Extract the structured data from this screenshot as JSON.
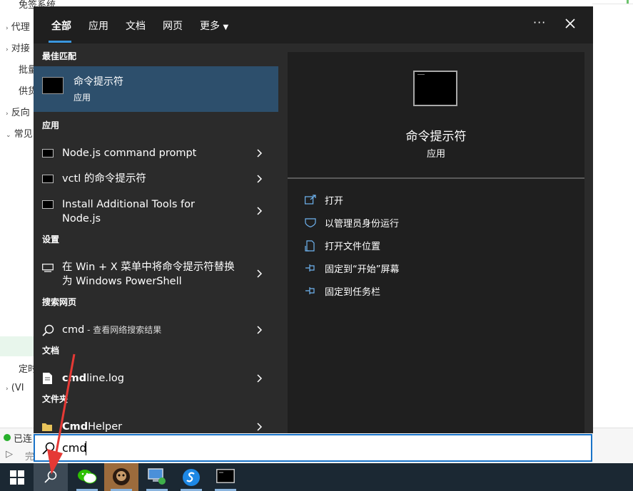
{
  "background_app": {
    "side_items": [
      "免签系统",
      "代理",
      "对接",
      "批量",
      "供货",
      "反向",
      "常见",
      "定时",
      "(VI"
    ],
    "status": "已连",
    "bottom_label": "完"
  },
  "search": {
    "tabs": [
      {
        "label": "全部",
        "active": true
      },
      {
        "label": "应用"
      },
      {
        "label": "文档"
      },
      {
        "label": "网页"
      },
      {
        "label": "更多"
      }
    ],
    "more_icon": "ellipsis-icon",
    "close_icon": "close-icon",
    "sections": {
      "best_match": "最佳匹配",
      "apps": "应用",
      "settings": "设置",
      "web": "搜索网页",
      "docs": "文档",
      "folders": "文件夹"
    },
    "best": {
      "title": "命令提示符",
      "subtitle": "应用"
    },
    "apps": [
      {
        "label": "Node.js command prompt"
      },
      {
        "label": "vctl 的命令提示符"
      },
      {
        "label": "Install Additional Tools for Node.js"
      }
    ],
    "setting": {
      "label": "在 Win + X 菜单中将命令提示符替换为 Windows PowerShell"
    },
    "web": {
      "label": "cmd",
      "suffix": " - 查看网络搜索结果"
    },
    "doc": {
      "bold": "cmd",
      "rest": "line.log"
    },
    "folder": {
      "bold": "Cmd",
      "rest": "Helper"
    },
    "preview": {
      "title": "命令提示符",
      "subtitle": "应用"
    },
    "actions": [
      {
        "label": "打开",
        "icon": "open-icon"
      },
      {
        "label": "以管理员身份运行",
        "icon": "shield-icon"
      },
      {
        "label": "打开文件位置",
        "icon": "file-location-icon"
      },
      {
        "label": "固定到“开始”屏幕",
        "icon": "pin-icon"
      },
      {
        "label": "固定到任务栏",
        "icon": "pin-icon"
      }
    ],
    "query": "cmd"
  },
  "taskbar": {
    "items": [
      "windows-start-icon",
      "search-icon",
      "wechat-icon",
      "app-avatar-icon",
      "network-app-icon",
      "browser-icon",
      "terminal-icon"
    ]
  },
  "colors": {
    "accent": "#3a96dd",
    "selected": "#2d4f6c",
    "panel": "#2b2b2b",
    "taskbar": "#1b2833",
    "arrow": "#e53935"
  }
}
